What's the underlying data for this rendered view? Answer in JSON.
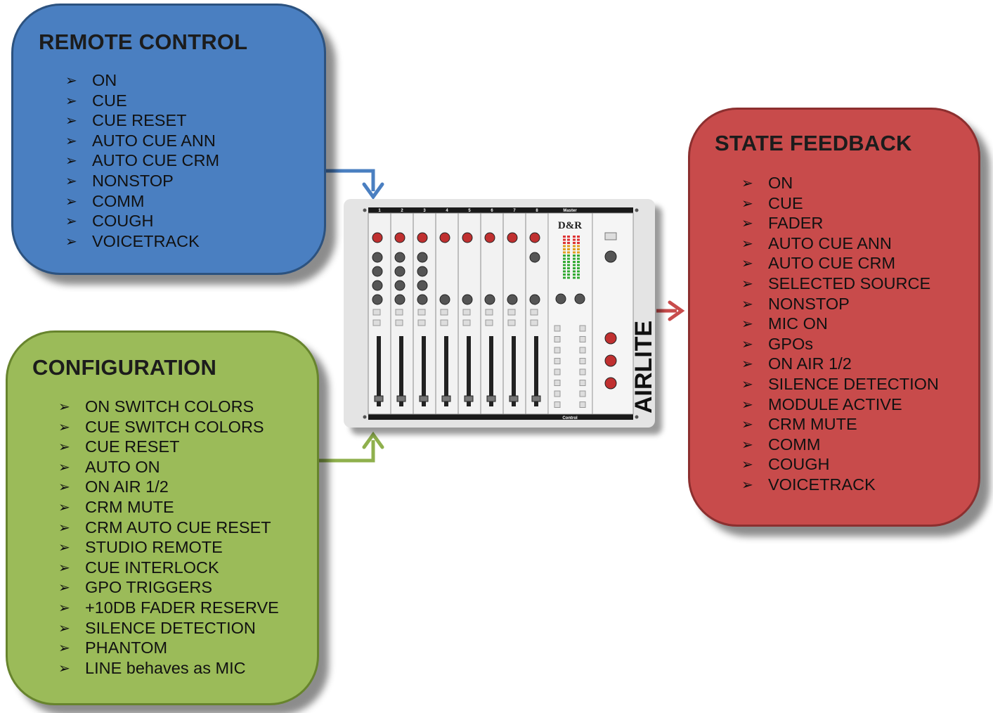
{
  "remote_control": {
    "title": "REMOTE CONTROL",
    "color": "#4a7fc1",
    "items": [
      "ON",
      "CUE",
      "CUE RESET",
      "AUTO CUE ANN",
      "AUTO CUE CRM",
      "NONSTOP",
      "COMM",
      "COUGH",
      "VOICETRACK"
    ]
  },
  "configuration": {
    "title": "CONFIGURATION",
    "color": "#9bbb59",
    "items": [
      "ON SWITCH COLORS",
      "CUE SWITCH COLORS",
      "CUE RESET",
      "AUTO ON",
      "ON AIR 1/2",
      "CRM MUTE",
      "CRM AUTO CUE RESET",
      "STUDIO REMOTE",
      "CUE INTERLOCK",
      "GPO TRIGGERS",
      "+10DB FADER RESERVE",
      "SILENCE DETECTION",
      "PHANTOM",
      "LINE behaves as MIC"
    ]
  },
  "state_feedback": {
    "title": "STATE FEEDBACK",
    "color": "#c84b4b",
    "items": [
      "ON",
      "CUE",
      "FADER",
      "AUTO CUE ANN",
      "AUTO CUE CRM",
      "SELECTED SOURCE",
      "NONSTOP",
      "MIC ON",
      "GPOs",
      "ON AIR 1/2",
      "SILENCE DETECTION",
      "MODULE ACTIVE",
      "CRM MUTE",
      "COMM",
      "COUGH",
      "VOICETRACK"
    ]
  },
  "mixer": {
    "brand": "AIRLITE",
    "logo": "D&R",
    "channel_numbers": [
      "1",
      "2",
      "3",
      "4",
      "5",
      "6",
      "7",
      "8"
    ],
    "master_label": "Master",
    "control_label": "Control"
  }
}
